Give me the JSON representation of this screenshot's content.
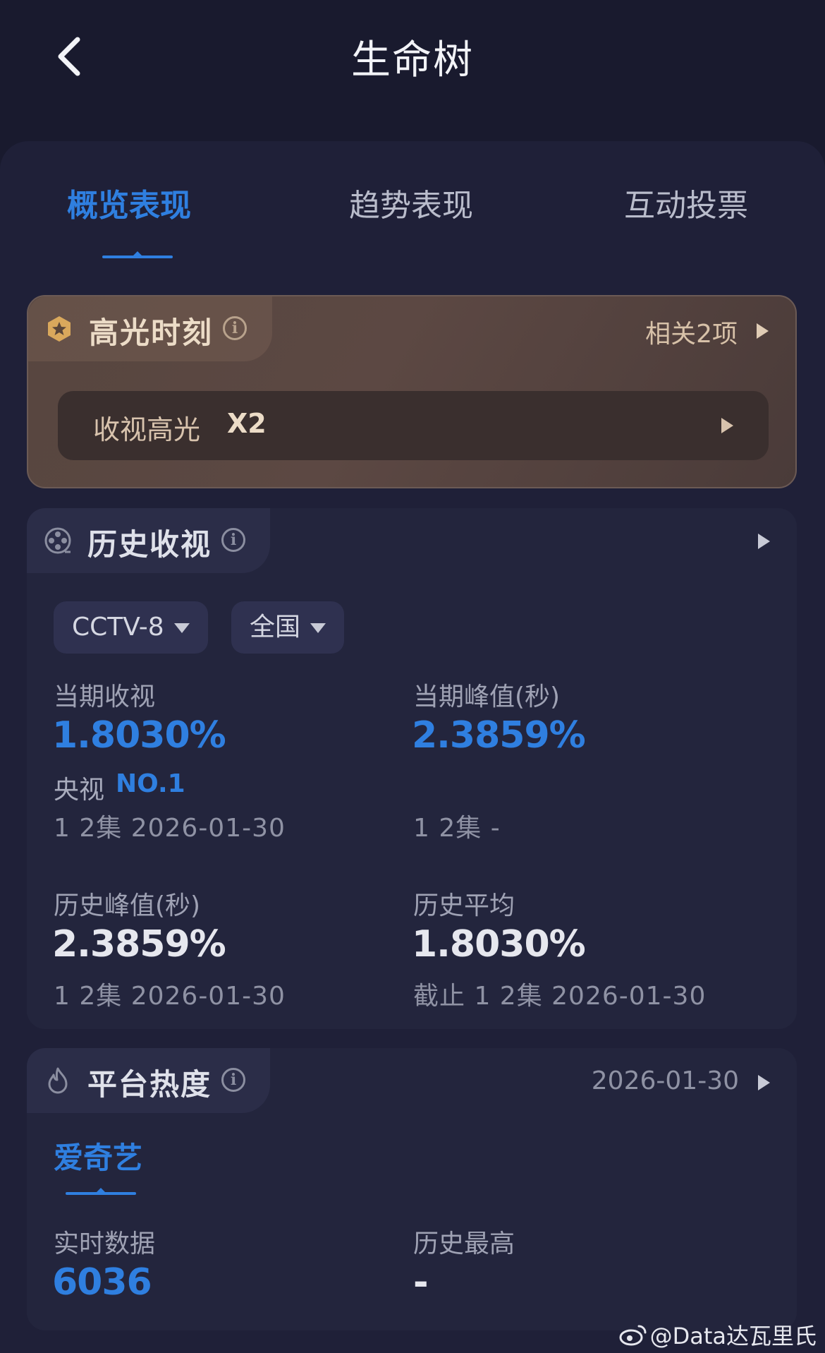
{
  "header": {
    "title": "生命树"
  },
  "tabs": [
    {
      "label": "概览表现",
      "active": true
    },
    {
      "label": "趋势表现",
      "active": false
    },
    {
      "label": "互动投票",
      "active": false
    }
  ],
  "highlight": {
    "title": "高光时刻",
    "link": "相关2项",
    "row_label": "收视高光",
    "row_value": "X2"
  },
  "history": {
    "title": "历史收视",
    "channel": "CCTV-8",
    "region": "全国",
    "current_label": "当期收视",
    "current_value": "1.8030%",
    "rank_prefix": "央视",
    "rank_value": "NO.1",
    "current_sub": "1 2集  2026-01-30",
    "peak_label": "当期峰值(秒)",
    "peak_value": "2.3859%",
    "peak_sub": "1 2集  -",
    "hist_peak_label": "历史峰值(秒)",
    "hist_peak_value": "2.3859%",
    "hist_peak_sub": "1 2集  2026-01-30",
    "hist_avg_label": "历史平均",
    "hist_avg_value": "1.8030%",
    "hist_avg_sub": "截止 1 2集  2026-01-30"
  },
  "heat": {
    "title": "平台热度",
    "date": "2026-01-30",
    "platform": "爱奇艺",
    "realtime_label": "实时数据",
    "realtime_value": "6036",
    "max_label": "历史最高",
    "max_value": "-"
  },
  "watermark": "@Data达瓦里氏",
  "colors": {
    "accent": "#2f7fe0",
    "background": "#191a2e",
    "card": "#23253d"
  }
}
